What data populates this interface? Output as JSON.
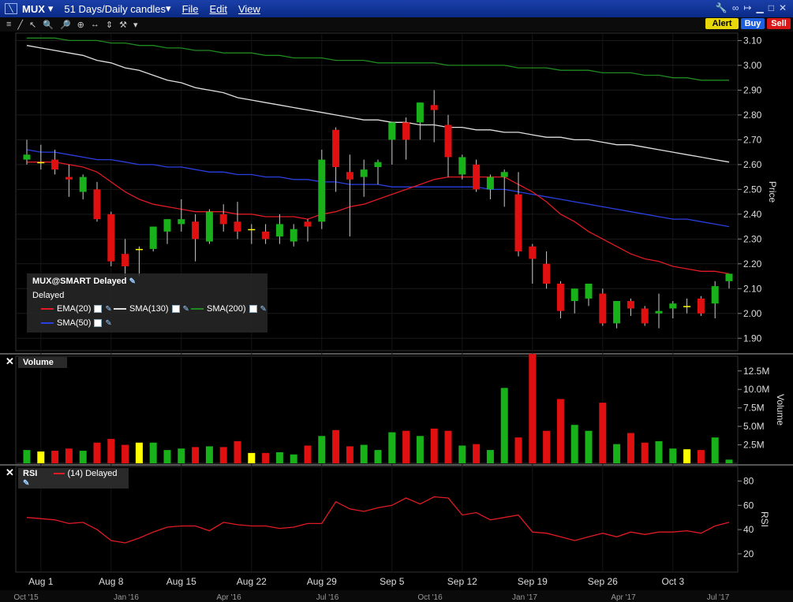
{
  "window": {
    "symbol": "MUX",
    "timeframe": "51 Days/Daily candles",
    "menus": [
      "File",
      "Edit",
      "View"
    ]
  },
  "buttons": {
    "alert": "Alert",
    "buy": "Buy",
    "sell": "Sell"
  },
  "legend": {
    "title": "MUX@SMART Delayed",
    "status": "Delayed",
    "items": [
      {
        "label": "EMA(20)",
        "color": "#e01b24"
      },
      {
        "label": "SMA(130)",
        "color": "#e0e0e0"
      },
      {
        "label": "SMA(200)",
        "color": "#1f8a1f"
      },
      {
        "label": "SMA(50)",
        "color": "#2a3fe0"
      }
    ]
  },
  "panels": {
    "volume_title": "Volume",
    "rsi_title": "RSI",
    "rsi_param": "(14) Delayed"
  },
  "colors": {
    "up": "#19b119",
    "down": "#e01010",
    "doji": "#ffff00"
  },
  "chart_data": [
    {
      "type": "candlestick",
      "ylabel": "Price",
      "ylim": [
        1.85,
        3.13
      ],
      "yticks": [
        "3.10",
        "3.00",
        "2.90",
        "2.80",
        "2.70",
        "2.60",
        "2.50",
        "2.40",
        "2.30",
        "2.20",
        "2.10",
        "2.00",
        "1.90"
      ],
      "xticks": [
        "Aug 1",
        "Aug 8",
        "Aug 15",
        "Aug 22",
        "Aug 29",
        "Sep 5",
        "Sep 12",
        "Sep 19",
        "Sep 26",
        "Oct 3"
      ],
      "candles": [
        {
          "o": 2.62,
          "h": 2.7,
          "l": 2.6,
          "c": 2.64
        },
        {
          "o": 2.61,
          "h": 2.68,
          "l": 2.58,
          "c": 2.61
        },
        {
          "o": 2.62,
          "h": 2.66,
          "l": 2.56,
          "c": 2.58
        },
        {
          "o": 2.55,
          "h": 2.6,
          "l": 2.47,
          "c": 2.54
        },
        {
          "o": 2.49,
          "h": 2.56,
          "l": 2.46,
          "c": 2.55
        },
        {
          "o": 2.5,
          "h": 2.53,
          "l": 2.37,
          "c": 2.38
        },
        {
          "o": 2.4,
          "h": 2.41,
          "l": 2.19,
          "c": 2.21
        },
        {
          "o": 2.24,
          "h": 2.3,
          "l": 2.15,
          "c": 2.19
        },
        {
          "o": 2.26,
          "h": 2.27,
          "l": 2.15,
          "c": 2.26
        },
        {
          "o": 2.26,
          "h": 2.35,
          "l": 2.25,
          "c": 2.35
        },
        {
          "o": 2.33,
          "h": 2.38,
          "l": 2.28,
          "c": 2.38
        },
        {
          "o": 2.36,
          "h": 2.46,
          "l": 2.33,
          "c": 2.38
        },
        {
          "o": 2.37,
          "h": 2.4,
          "l": 2.21,
          "c": 2.3
        },
        {
          "o": 2.29,
          "h": 2.42,
          "l": 2.28,
          "c": 2.41
        },
        {
          "o": 2.4,
          "h": 2.44,
          "l": 2.33,
          "c": 2.36
        },
        {
          "o": 2.37,
          "h": 2.45,
          "l": 2.3,
          "c": 2.33
        },
        {
          "o": 2.34,
          "h": 2.36,
          "l": 2.28,
          "c": 2.34
        },
        {
          "o": 2.33,
          "h": 2.36,
          "l": 2.28,
          "c": 2.3
        },
        {
          "o": 2.31,
          "h": 2.4,
          "l": 2.28,
          "c": 2.36
        },
        {
          "o": 2.29,
          "h": 2.36,
          "l": 2.27,
          "c": 2.34
        },
        {
          "o": 2.37,
          "h": 2.38,
          "l": 2.29,
          "c": 2.35
        },
        {
          "o": 2.37,
          "h": 2.66,
          "l": 2.34,
          "c": 2.62
        },
        {
          "o": 2.74,
          "h": 2.75,
          "l": 2.49,
          "c": 2.59
        },
        {
          "o": 2.57,
          "h": 2.64,
          "l": 2.31,
          "c": 2.54
        },
        {
          "o": 2.55,
          "h": 2.62,
          "l": 2.47,
          "c": 2.58
        },
        {
          "o": 2.59,
          "h": 2.62,
          "l": 2.52,
          "c": 2.61
        },
        {
          "o": 2.7,
          "h": 2.77,
          "l": 2.6,
          "c": 2.77
        },
        {
          "o": 2.77,
          "h": 2.79,
          "l": 2.62,
          "c": 2.7
        },
        {
          "o": 2.77,
          "h": 2.85,
          "l": 2.7,
          "c": 2.85
        },
        {
          "o": 2.84,
          "h": 2.9,
          "l": 2.69,
          "c": 2.82
        },
        {
          "o": 2.76,
          "h": 2.8,
          "l": 2.55,
          "c": 2.63
        },
        {
          "o": 2.56,
          "h": 2.64,
          "l": 2.54,
          "c": 2.63
        },
        {
          "o": 2.6,
          "h": 2.62,
          "l": 2.49,
          "c": 2.5
        },
        {
          "o": 2.5,
          "h": 2.56,
          "l": 2.46,
          "c": 2.55
        },
        {
          "o": 2.55,
          "h": 2.58,
          "l": 2.43,
          "c": 2.57
        },
        {
          "o": 2.48,
          "h": 2.57,
          "l": 2.23,
          "c": 2.25
        },
        {
          "o": 2.27,
          "h": 2.28,
          "l": 2.12,
          "c": 2.22
        },
        {
          "o": 2.2,
          "h": 2.25,
          "l": 2.1,
          "c": 2.12
        },
        {
          "o": 2.12,
          "h": 2.13,
          "l": 1.98,
          "c": 2.01
        },
        {
          "o": 2.05,
          "h": 2.1,
          "l": 2.0,
          "c": 2.1
        },
        {
          "o": 2.06,
          "h": 2.12,
          "l": 2.03,
          "c": 2.12
        },
        {
          "o": 2.08,
          "h": 2.1,
          "l": 1.95,
          "c": 1.96
        },
        {
          "o": 1.96,
          "h": 2.05,
          "l": 1.94,
          "c": 2.05
        },
        {
          "o": 2.05,
          "h": 2.06,
          "l": 1.99,
          "c": 2.02
        },
        {
          "o": 2.02,
          "h": 2.03,
          "l": 1.95,
          "c": 1.96
        },
        {
          "o": 2.0,
          "h": 2.08,
          "l": 1.94,
          "c": 2.01
        },
        {
          "o": 2.02,
          "h": 2.05,
          "l": 1.98,
          "c": 2.04
        },
        {
          "o": 2.03,
          "h": 2.06,
          "l": 2.0,
          "c": 2.03
        },
        {
          "o": 2.06,
          "h": 2.07,
          "l": 1.99,
          "c": 2.0
        },
        {
          "o": 2.04,
          "h": 2.13,
          "l": 1.98,
          "c": 2.11
        },
        {
          "o": 2.13,
          "h": 2.16,
          "l": 2.1,
          "c": 2.16
        }
      ],
      "ema20": [
        2.61,
        2.61,
        2.61,
        2.6,
        2.59,
        2.57,
        2.53,
        2.49,
        2.46,
        2.44,
        2.43,
        2.42,
        2.41,
        2.41,
        2.41,
        2.4,
        2.4,
        2.39,
        2.39,
        2.39,
        2.38,
        2.4,
        2.41,
        2.43,
        2.44,
        2.46,
        2.48,
        2.5,
        2.52,
        2.54,
        2.55,
        2.55,
        2.55,
        2.55,
        2.55,
        2.52,
        2.49,
        2.45,
        2.4,
        2.37,
        2.33,
        2.3,
        2.27,
        2.24,
        2.22,
        2.21,
        2.19,
        2.18,
        2.17,
        2.17,
        2.16
      ],
      "sma50": [
        2.66,
        2.65,
        2.65,
        2.64,
        2.63,
        2.62,
        2.62,
        2.61,
        2.6,
        2.6,
        2.59,
        2.59,
        2.58,
        2.57,
        2.57,
        2.56,
        2.56,
        2.55,
        2.55,
        2.54,
        2.54,
        2.53,
        2.53,
        2.52,
        2.52,
        2.52,
        2.51,
        2.51,
        2.51,
        2.51,
        2.51,
        2.51,
        2.51,
        2.5,
        2.5,
        2.49,
        2.48,
        2.47,
        2.46,
        2.45,
        2.44,
        2.43,
        2.42,
        2.41,
        2.4,
        2.39,
        2.38,
        2.38,
        2.37,
        2.36,
        2.35
      ],
      "sma130": [
        3.08,
        3.07,
        3.06,
        3.05,
        3.04,
        3.02,
        3.01,
        2.99,
        2.98,
        2.96,
        2.94,
        2.93,
        2.91,
        2.9,
        2.89,
        2.87,
        2.86,
        2.85,
        2.84,
        2.83,
        2.82,
        2.81,
        2.8,
        2.79,
        2.78,
        2.78,
        2.77,
        2.77,
        2.76,
        2.76,
        2.75,
        2.75,
        2.74,
        2.74,
        2.73,
        2.73,
        2.72,
        2.71,
        2.71,
        2.7,
        2.7,
        2.69,
        2.68,
        2.68,
        2.67,
        2.66,
        2.65,
        2.64,
        2.63,
        2.62,
        2.61
      ],
      "sma200": [
        3.11,
        3.11,
        3.11,
        3.1,
        3.1,
        3.1,
        3.09,
        3.09,
        3.08,
        3.08,
        3.07,
        3.07,
        3.06,
        3.06,
        3.05,
        3.05,
        3.05,
        3.04,
        3.04,
        3.03,
        3.03,
        3.03,
        3.02,
        3.02,
        3.02,
        3.01,
        3.01,
        3.01,
        3.01,
        3.01,
        3.0,
        3.0,
        3.0,
        3.0,
        3.0,
        2.99,
        2.99,
        2.99,
        2.98,
        2.98,
        2.98,
        2.97,
        2.97,
        2.97,
        2.96,
        2.96,
        2.95,
        2.95,
        2.94,
        2.94,
        2.94
      ]
    },
    {
      "type": "bar",
      "ylabel": "Volume",
      "ylim": [
        0,
        14.5
      ],
      "yticks": [
        "12.5M",
        "10.0M",
        "7.5M",
        "5.0M",
        "2.5M"
      ],
      "values": [
        1.8,
        1.6,
        1.7,
        2.0,
        1.7,
        2.8,
        3.3,
        2.5,
        2.8,
        2.8,
        1.8,
        2.0,
        2.2,
        2.3,
        2.2,
        3.0,
        1.4,
        1.4,
        1.5,
        1.2,
        2.4,
        3.7,
        4.5,
        2.3,
        2.5,
        1.8,
        4.2,
        4.4,
        3.7,
        4.7,
        4.4,
        2.4,
        2.6,
        1.8,
        10.2,
        3.5,
        14.8,
        4.4,
        8.7,
        5.2,
        4.4,
        8.2,
        2.6,
        4.1,
        2.8,
        3.0,
        2.0,
        1.9,
        1.8,
        3.5,
        0.5
      ]
    },
    {
      "type": "line",
      "ylabel": "RSI",
      "ylim": [
        5,
        92
      ],
      "yticks": [
        "80",
        "60",
        "40",
        "20"
      ],
      "values": [
        50,
        49,
        48,
        45,
        46,
        40,
        31,
        29,
        33,
        38,
        42,
        43,
        43,
        39,
        46,
        44,
        43,
        43,
        41,
        42,
        45,
        45,
        63,
        57,
        55,
        58,
        60,
        66,
        61,
        67,
        66,
        52,
        54,
        48,
        50,
        52,
        38,
        37,
        34,
        31,
        34,
        37,
        34,
        38,
        36,
        38,
        38,
        39,
        37,
        43,
        46
      ]
    }
  ],
  "bottom_axis": [
    "Oct '15",
    "Jan '16",
    "Apr '16",
    "Jul '16",
    "Oct '16",
    "Jan '17",
    "Apr '17",
    "Jul '17"
  ]
}
